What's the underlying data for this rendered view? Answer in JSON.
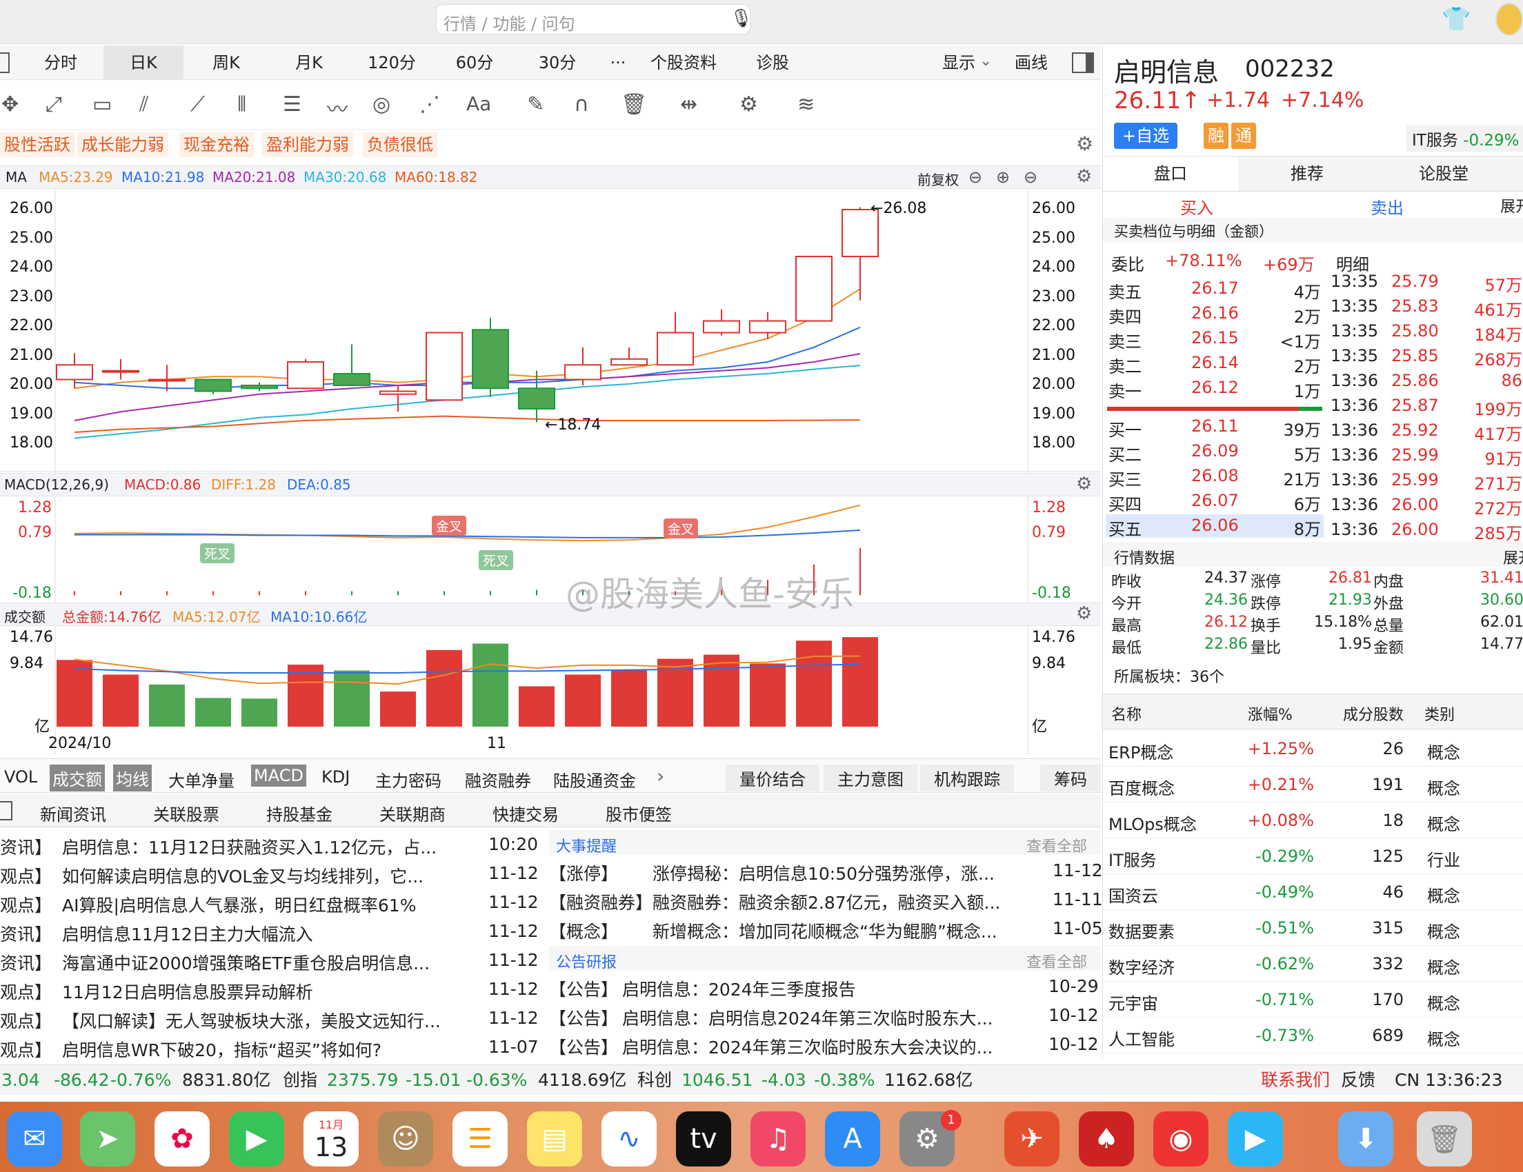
{
  "search": {
    "placeholder": "行情 / 功能 / 问句"
  },
  "period_tabs": [
    "分时",
    "日K",
    "周K",
    "月K",
    "120分",
    "60分",
    "30分",
    "···",
    "个股资料",
    "诊股"
  ],
  "display_label": "显示",
  "draw_label": "画线",
  "tags": [
    "股性活跃",
    "成长能力弱",
    "现金充裕",
    "盈利能力弱",
    "负债很低"
  ],
  "ma_bar": {
    "label": "MA",
    "ma5": "MA5:23.29",
    "ma10": "MA10:21.98",
    "ma20": "MA20:21.08",
    "ma30": "MA30:20.68",
    "ma60": "MA60:18.82",
    "adjust": "前复权"
  },
  "price_axis": [
    "26.00",
    "25.00",
    "24.00",
    "23.00",
    "22.00",
    "21.00",
    "20.00",
    "19.00",
    "18.00"
  ],
  "annotations": {
    "high": "26.08",
    "low": "18.74"
  },
  "macd_bar": {
    "label": "MACD(12,26,9)",
    "macd": "MACD:0.86",
    "diff": "DIFF:1.28",
    "dea": "DEA:0.85"
  },
  "macd_axis": [
    "1.28",
    "0.79",
    "-0.18"
  ],
  "macd_tags": {
    "gold": "金叉",
    "dead": "死叉"
  },
  "vol_bar": {
    "label": "成交额",
    "total": "总金额:14.76亿",
    "ma5": "MA5:12.07亿",
    "ma10": "MA10:10.66亿"
  },
  "vol_axis": [
    "14.76",
    "9.84",
    "亿"
  ],
  "date_axis": [
    "2024/10",
    "11"
  ],
  "indicator_tabs": [
    "VOL",
    "成交额",
    "均线",
    "大单净量",
    "MACD",
    "KDJ",
    "主力密码",
    "融资融券",
    "陆股通资金"
  ],
  "indicator_right_tabs": [
    "量价结合",
    "主力意图",
    "机构跟踪",
    "筹码"
  ],
  "news_tabs": [
    "新闻资讯",
    "关联股票",
    "持股基金",
    "关联期商",
    "快捷交易",
    "股市便签"
  ],
  "news": [
    {
      "tag": "资讯】",
      "title": "启明信息：11月12日获融资买入1.12亿元，占...",
      "date": "10:20"
    },
    {
      "tag": "观点】",
      "title": "如何解读启明信息的VOL金叉与均线排列，它...",
      "date": "11-12"
    },
    {
      "tag": "观点】",
      "title": "AI算股|启明信息人气暴涨，明日红盘概率61%",
      "date": "11-12"
    },
    {
      "tag": "资讯】",
      "title": "启明信息11月12日主力大幅流入",
      "date": "11-12"
    },
    {
      "tag": "资讯】",
      "title": "海富通中证2000增强策略ETF重仓股启明信息...",
      "date": "11-12"
    },
    {
      "tag": "观点】",
      "title": "11月12日启明信息股票异动解析",
      "date": "11-12"
    },
    {
      "tag": "观点】",
      "title": "【风口解读】无人驾驶板块大涨，美股文远知行...",
      "date": "11-12"
    },
    {
      "tag": "观点】",
      "title": "启明信息WR下破20，指标“超买”将如何?",
      "date": "11-07"
    }
  ],
  "events_title": "大事提醒",
  "events_more": "查看全部",
  "events": [
    {
      "tag": "【涨停】",
      "title": "涨停揭秘：启明信息10:50分强势涨停，涨...",
      "date": "11-12"
    },
    {
      "tag": "【融资融券】",
      "title": "融资融券：融资余额2.87亿元，融资买入额...",
      "date": "11-11"
    },
    {
      "tag": "【概念】",
      "title": "新增概念：增加同花顺概念“华为鲲鹏”概念...",
      "date": "11-05"
    }
  ],
  "notices_title": "公告研报",
  "notices_more": "查看全部",
  "notices": [
    {
      "tag": "【公告】",
      "title": "启明信息：2024年三季度报告",
      "date": "10-29"
    },
    {
      "tag": "【公告】",
      "title": "启明信息：启明信息2024年第三次临时股东大...",
      "date": "10-12"
    },
    {
      "tag": "【公告】",
      "title": "启明信息：2024年第三次临时股东大会决议的...",
      "date": "10-12"
    }
  ],
  "stock": {
    "name": "启明信息",
    "code": "002232",
    "price": "26.11↑",
    "change": "+1.74",
    "pct": "+7.14%",
    "fav": "+自选",
    "rong": "融",
    "tong": "通",
    "sector": "IT服务",
    "sector_pct": "-0.29%"
  },
  "right_tabs": [
    "盘口",
    "推荐",
    "论股堂"
  ],
  "buy_sell": {
    "buy": "买入",
    "sell": "卖出",
    "expand": "展开"
  },
  "order_title": "买卖档位与明细（金额）",
  "weibi": {
    "label": "委比",
    "pct": "+78.11%",
    "amt": "+69万",
    "detail": "明细"
  },
  "asks": [
    {
      "l": "卖五",
      "p": "26.17",
      "v": "4万"
    },
    {
      "l": "卖四",
      "p": "26.16",
      "v": "2万"
    },
    {
      "l": "卖三",
      "p": "26.15",
      "v": "<1万"
    },
    {
      "l": "卖二",
      "p": "26.14",
      "v": "2万"
    },
    {
      "l": "卖一",
      "p": "26.12",
      "v": "1万"
    }
  ],
  "bids": [
    {
      "l": "买一",
      "p": "26.11",
      "v": "39万"
    },
    {
      "l": "买二",
      "p": "26.09",
      "v": "5万"
    },
    {
      "l": "买三",
      "p": "26.08",
      "v": "21万"
    },
    {
      "l": "买四",
      "p": "26.07",
      "v": "6万"
    },
    {
      "l": "买五",
      "p": "26.06",
      "v": "8万"
    }
  ],
  "ticks": [
    {
      "t": "13:35",
      "p": "25.79",
      "v": "57万"
    },
    {
      "t": "13:35",
      "p": "25.83",
      "v": "461万"
    },
    {
      "t": "13:35",
      "p": "25.80",
      "v": "184万"
    },
    {
      "t": "13:35",
      "p": "25.85",
      "v": "268万"
    },
    {
      "t": "13:36",
      "p": "25.86",
      "v": "86"
    },
    {
      "t": "13:36",
      "p": "25.87",
      "v": "199万"
    },
    {
      "t": "13:36",
      "p": "25.92",
      "v": "417万"
    },
    {
      "t": "13:36",
      "p": "25.99",
      "v": "91万"
    },
    {
      "t": "13:36",
      "p": "25.99",
      "v": "271万"
    },
    {
      "t": "13:36",
      "p": "26.00",
      "v": "272万"
    },
    {
      "t": "13:36",
      "p": "26.00",
      "v": "285万"
    }
  ],
  "quote_title": "行情数据",
  "quote_expand": "展开",
  "quote": [
    {
      "a": "昨收",
      "b": "24.37",
      "c": "涨停",
      "d": "26.81",
      "e": "内盘",
      "f": "31.41"
    },
    {
      "a": "今开",
      "b": "24.36",
      "c": "跌停",
      "d": "21.93",
      "e": "外盘",
      "f": "30.60"
    },
    {
      "a": "最高",
      "b": "26.12",
      "c": "换手",
      "d": "15.18%",
      "e": "总量",
      "f": "62.01"
    },
    {
      "a": "最低",
      "b": "22.86",
      "c": "量比",
      "d": "1.95",
      "e": "金额",
      "f": "14.77"
    }
  ],
  "sector_count": "所属板块：36个",
  "sector_head": [
    "名称",
    "涨幅%",
    "成分股数",
    "类别"
  ],
  "sectors": [
    {
      "n": "ERP概念",
      "p": "+1.25%",
      "c": "26",
      "t": "概念"
    },
    {
      "n": "百度概念",
      "p": "+0.21%",
      "c": "191",
      "t": "概念"
    },
    {
      "n": "MLOps概念",
      "p": "+0.08%",
      "c": "18",
      "t": "概念"
    },
    {
      "n": "IT服务",
      "p": "-0.29%",
      "c": "125",
      "t": "行业"
    },
    {
      "n": "国资云",
      "p": "-0.49%",
      "c": "46",
      "t": "概念"
    },
    {
      "n": "数据要素",
      "p": "-0.51%",
      "c": "315",
      "t": "概念"
    },
    {
      "n": "数字经济",
      "p": "-0.62%",
      "c": "332",
      "t": "概念"
    },
    {
      "n": "元宇宙",
      "p": "-0.71%",
      "c": "170",
      "t": "概念"
    },
    {
      "n": "人工智能",
      "p": "-0.73%",
      "c": "689",
      "t": "概念"
    }
  ],
  "status": {
    "a": "3.04",
    "b": "-86.42",
    "c": "-0.76%",
    "d": "8831.80亿",
    "e": "创指",
    "f": "2375.79",
    "g": "-15.01",
    "h": "-0.63%",
    "i": "4118.69亿",
    "j": "科创",
    "k": "1046.51",
    "l": "-4.03",
    "m": "-0.38%",
    "n": "1162.68亿",
    "contact": "联系我们",
    "feedback": "反馈",
    "clock": "CN 13:36:23"
  },
  "watermark": "@股海美人鱼-安乐",
  "dock_date": {
    "month": "11月",
    "day": "13"
  },
  "dock_badge": "1",
  "chart_data": {
    "type": "candlestick",
    "candles": [
      {
        "o": 20.2,
        "c": 20.7,
        "h": 21.1,
        "l": 19.9
      },
      {
        "o": 20.5,
        "c": 20.5,
        "h": 20.9,
        "l": 20.2
      },
      {
        "o": 20.2,
        "c": 20.2,
        "h": 20.7,
        "l": 19.8
      },
      {
        "o": 20.2,
        "c": 19.8,
        "h": 20.2,
        "l": 19.7
      },
      {
        "o": 20.0,
        "c": 19.9,
        "h": 20.1,
        "l": 19.8
      },
      {
        "o": 19.9,
        "c": 20.8,
        "h": 20.9,
        "l": 19.9
      },
      {
        "o": 20.4,
        "c": 20.0,
        "h": 21.4,
        "l": 20.0
      },
      {
        "o": 19.7,
        "c": 19.8,
        "h": 20.0,
        "l": 19.1
      },
      {
        "o": 19.5,
        "c": 21.8,
        "h": 21.8,
        "l": 19.5
      },
      {
        "o": 21.9,
        "c": 19.9,
        "h": 22.3,
        "l": 19.6
      },
      {
        "o": 19.9,
        "c": 19.2,
        "h": 20.5,
        "l": 18.74
      },
      {
        "o": 20.2,
        "c": 20.7,
        "h": 21.3,
        "l": 20.0
      },
      {
        "o": 20.7,
        "c": 20.9,
        "h": 21.3,
        "l": 20.7
      },
      {
        "o": 20.7,
        "c": 21.8,
        "h": 22.5,
        "l": 20.7
      },
      {
        "o": 21.8,
        "c": 22.2,
        "h": 22.6,
        "l": 21.7
      },
      {
        "o": 21.8,
        "c": 22.2,
        "h": 22.5,
        "l": 21.6
      },
      {
        "o": 22.2,
        "c": 24.4,
        "h": 24.4,
        "l": 22.2
      },
      {
        "o": 24.4,
        "c": 26.0,
        "h": 26.08,
        "l": 22.9
      }
    ],
    "volume": [
      11.4,
      8.9,
      7.2,
      4.9,
      4.8,
      10.6,
      9.6,
      6.0,
      13.1,
      14.2,
      6.9,
      8.9,
      9.6,
      11.6,
      12.3,
      10.8,
      14.7,
      15.3
    ],
    "volume_up": [
      true,
      true,
      false,
      false,
      false,
      true,
      false,
      true,
      true,
      false,
      true,
      true,
      true,
      true,
      true,
      true,
      true,
      true
    ],
    "ma5": [
      19.9,
      20.1,
      20.2,
      20.3,
      20.3,
      20.2,
      20.2,
      20.1,
      20.2,
      20.4,
      20.3,
      20.4,
      20.6,
      20.8,
      21.2,
      21.6,
      22.3,
      23.29
    ],
    "ma10": [
      20.1,
      20.0,
      19.9,
      19.9,
      20.0,
      20.0,
      20.1,
      20.0,
      20.0,
      20.1,
      20.1,
      20.2,
      20.3,
      20.5,
      20.6,
      20.8,
      21.3,
      21.98
    ],
    "ma20": [
      18.8,
      19.1,
      19.3,
      19.5,
      19.7,
      19.8,
      19.9,
      20.0,
      20.1,
      20.1,
      20.2,
      20.2,
      20.3,
      20.4,
      20.5,
      20.6,
      20.8,
      21.08
    ],
    "ma30": [
      18.2,
      18.35,
      18.5,
      18.7,
      18.9,
      19.0,
      19.2,
      19.35,
      19.5,
      19.65,
      19.8,
      19.95,
      20.05,
      20.2,
      20.3,
      20.4,
      20.55,
      20.68
    ],
    "ma60": [
      18.4,
      18.5,
      18.55,
      18.6,
      18.7,
      18.8,
      18.85,
      18.9,
      18.95,
      18.9,
      18.85,
      18.8,
      18.8,
      18.8,
      18.8,
      18.8,
      18.81,
      18.82
    ],
    "diff": [
      0.79,
      0.8,
      0.79,
      0.78,
      0.77,
      0.76,
      0.74,
      0.72,
      0.73,
      0.7,
      0.68,
      0.67,
      0.68,
      0.72,
      0.78,
      0.9,
      1.08,
      1.28
    ],
    "dea": [
      0.77,
      0.77,
      0.77,
      0.77,
      0.76,
      0.76,
      0.76,
      0.75,
      0.75,
      0.74,
      0.73,
      0.72,
      0.72,
      0.72,
      0.73,
      0.76,
      0.8,
      0.85
    ],
    "price_range": [
      17.6,
      26.6
    ],
    "volume_max": 16.5
  }
}
